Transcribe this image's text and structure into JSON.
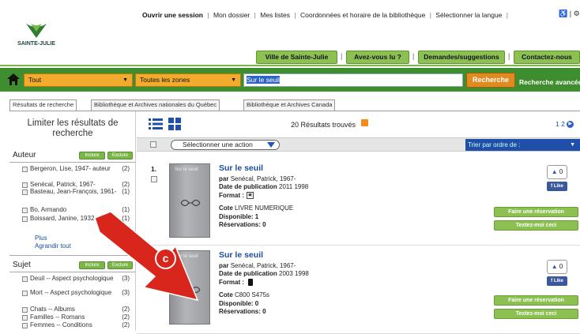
{
  "topnav": {
    "login": "Ouvrir une session",
    "links": [
      "Mon dossier",
      "Mes listes",
      "Coordonnées et horaire de la bibliothèque",
      "Sélectionner la langue"
    ],
    "sep": "|"
  },
  "logo": {
    "text": "SAINTE-JULIE"
  },
  "nav": {
    "buttons": [
      "Ville de Sainte-Julie",
      "Avez-vous lu ?",
      "Demandes/suggestions",
      "Contactez-nous"
    ]
  },
  "search": {
    "scope": "Tout",
    "zones": "Toutes les zones",
    "query": "Sur le seuil",
    "button": "Recherche",
    "advanced": "Recherche avancée"
  },
  "tabs": [
    "Résultats de recherche",
    "Bibliothèque et Archives nationales du Québec",
    "Bibliothèque et Archives Canada"
  ],
  "facets": {
    "title": "Limiter les résultats de recherche",
    "include": "Inclure",
    "exclude": "Exclure",
    "author": {
      "label": "Auteur",
      "items": [
        {
          "name": "Bergeron, Lise, 1947- auteur",
          "count": "(2)"
        },
        {
          "name": "Senécal, Patrick, 1967-",
          "count": "(2)"
        },
        {
          "name": "Basteau, Jean-François, 1961-",
          "count": "(1)"
        },
        {
          "name": "Bo, Armando",
          "count": "(1)"
        },
        {
          "name": "Boissard, Janine, 1932- auteur",
          "count": "(1)"
        }
      ],
      "more": "Plus",
      "expand": "Agrandir tout"
    },
    "subject": {
      "label": "Sujet",
      "items": [
        {
          "name": "Deuil -- Aspect psychologique",
          "count": "(3)"
        },
        {
          "name": "Mort -- Aspect psychologique",
          "count": "(3)"
        },
        {
          "name": "Chats -- Albums",
          "count": "(2)"
        },
        {
          "name": "Familles -- Romans",
          "count": "(2)"
        },
        {
          "name": "Femmes -- Conditions",
          "count": "(2)"
        }
      ]
    }
  },
  "results": {
    "count": "20 Résultats trouvés",
    "pages": "1 2",
    "action": "Sélectionner une action",
    "sort": "Trier par ordre de :",
    "items": [
      {
        "num": "1.",
        "cover": "Sur le seuil",
        "title": "Sur le seuil",
        "author_label": "par",
        "author": "Senécal, Patrick, 1967-",
        "date_label": "Date de publication",
        "date": "2011 1998",
        "format_label": "Format :",
        "cote_label": "Cote",
        "cote": "LIVRE NUMERIQUE",
        "available": "Disponible: 1",
        "reservations": "Réservations: 0",
        "likes": "0"
      },
      {
        "num": "",
        "cover": "Sur le seuil",
        "title": "Sur le seuil",
        "author_label": "par",
        "author": "Senécal, Patrick, 1967-",
        "date_label": "Date de publication",
        "date": "2003 1998",
        "format_label": "Format :",
        "cote_label": "Cote",
        "cote": "C800 S475s",
        "available": "Disponible: 0",
        "reservations": "Réservations: 0",
        "likes": "0"
      }
    ],
    "like": "Like",
    "reserve": "Faire une réservation",
    "text_me": "Textez-moi ceci"
  },
  "annotation": {
    "badge": "c"
  },
  "colors": {
    "accent_green": "#8cc152",
    "search_bar": "#3e8e2f",
    "orange": "#f2ab2c",
    "arrow": "#d9261c"
  }
}
